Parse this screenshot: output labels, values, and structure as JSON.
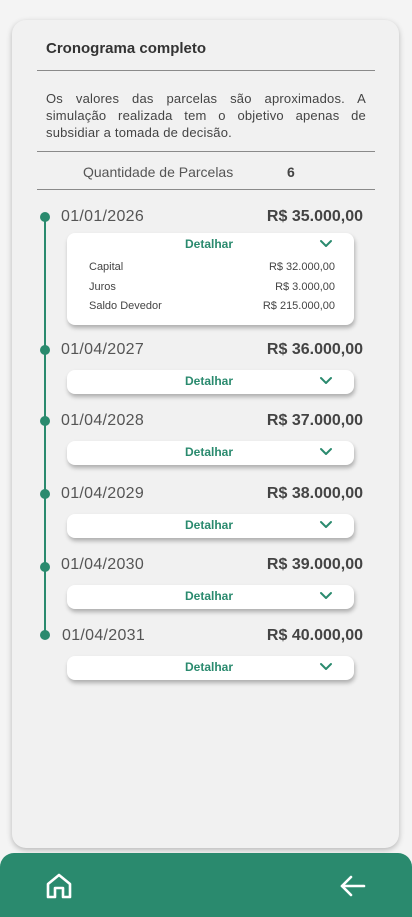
{
  "header": {
    "title": "Cronograma completo"
  },
  "notice": "Os valores das parcelas são aproximados. A simulação realizada tem o objetivo apenas de subsidiar a tomada de decisão.",
  "quantity": {
    "label": "Quantidade de Parcelas",
    "value": "6"
  },
  "installments": [
    {
      "date": "01/01/2026",
      "amount": "R$ 35.000,00",
      "detail_label": "Detalhar",
      "expanded": true,
      "rows": [
        {
          "label": "Capital",
          "value": "R$ 32.000,00"
        },
        {
          "label": "Juros",
          "value": "R$ 3.000,00"
        },
        {
          "label": "Saldo Devedor",
          "value": "R$ 215.000,00"
        }
      ]
    },
    {
      "date": "01/04/2027",
      "amount": "R$ 36.000,00",
      "detail_label": "Detalhar",
      "expanded": false
    },
    {
      "date": "01/04/2028",
      "amount": "R$ 37.000,00",
      "detail_label": "Detalhar",
      "expanded": false
    },
    {
      "date": "01/04/2029",
      "amount": "R$ 38.000,00",
      "detail_label": "Detalhar",
      "expanded": false
    },
    {
      "date": "01/04/2030",
      "amount": "R$ 39.000,00",
      "detail_label": "Detalhar",
      "expanded": false
    },
    {
      "date": "01/04/2031",
      "amount": "R$ 40.000,00",
      "detail_label": "Detalhar",
      "expanded": false
    }
  ],
  "bottom_nav": {
    "home_icon": "home-icon",
    "back_icon": "arrow-left-icon"
  },
  "colors": {
    "accent": "#2a8a6e",
    "background": "#f1f1f1",
    "text": "#444444"
  }
}
